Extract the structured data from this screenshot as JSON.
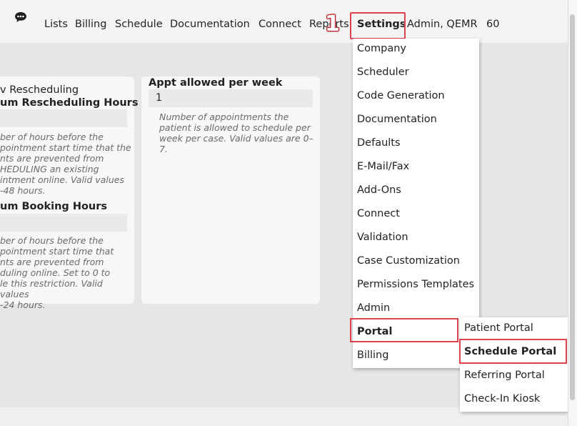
{
  "annotation": {
    "step_number": "1"
  },
  "nav": {
    "items": [
      "Lists",
      "Billing",
      "Schedule",
      "Documentation",
      "Connect",
      "Reports",
      "Settings",
      "Admin, QEMR",
      "60"
    ],
    "active": "Settings"
  },
  "left_card": {
    "line1": "v Rescheduling",
    "label_reschedule": "um Rescheduling Hours",
    "help_reschedule": "ber of hours before the\npointment start time that the\nnts are prevented from\nHEDULING an existing\nintment online. Valid values\n-48 hours.",
    "label_booking": "um Booking Hours",
    "help_booking": "ber of hours before the\npointment start time that\nnts are prevented from\nduling online. Set to 0 to\nle this restriction. Valid values\n-24 hours."
  },
  "mid_card": {
    "label": "Appt allowed per week",
    "value": "1",
    "help": "Number of appointments the\npatient is allowed to schedule per\nweek per case. Valid values are 0–7."
  },
  "settings_menu": {
    "items": [
      "Company",
      "Scheduler",
      "Code Generation",
      "Documentation",
      "Defaults",
      "E-Mail/Fax",
      "Add-Ons",
      "Connect",
      "Validation",
      "Case Customization",
      "Permissions Templates",
      "Admin",
      "Portal",
      "Billing"
    ]
  },
  "portal_submenu": {
    "items": [
      "Patient Portal",
      "Schedule Portal",
      "Referring Portal",
      "Check-In Kiosk"
    ]
  },
  "colors": {
    "highlight": "#e0434d",
    "page_bg": "#e6e6e6",
    "topbar_bg": "#f4f4f4",
    "card_bg": "#f7f7f7"
  },
  "icons": {
    "chat": "chat-bubble-icon"
  }
}
